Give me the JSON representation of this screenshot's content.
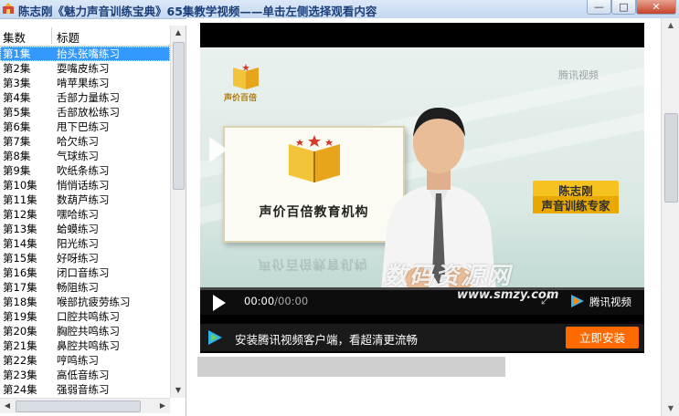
{
  "window": {
    "title": "陈志刚《魅力声音训练宝典》65集教学视频——单击左侧选择观看内容",
    "minimize_glyph": "—",
    "maximize_glyph": "□",
    "close_glyph": "✕"
  },
  "list": {
    "columns": [
      "集数",
      "标题"
    ],
    "selected_index": 0,
    "rows": [
      {
        "ep": "第1集",
        "title": "抬头张嘴练习"
      },
      {
        "ep": "第2集",
        "title": "耍嘴皮练习"
      },
      {
        "ep": "第3集",
        "title": "啃苹果练习"
      },
      {
        "ep": "第4集",
        "title": "舌部力量练习"
      },
      {
        "ep": "第5集",
        "title": "舌部放松练习"
      },
      {
        "ep": "第6集",
        "title": "甩下巴练习"
      },
      {
        "ep": "第7集",
        "title": "哈欠练习"
      },
      {
        "ep": "第8集",
        "title": "气球练习"
      },
      {
        "ep": "第9集",
        "title": "吹纸条练习"
      },
      {
        "ep": "第10集",
        "title": "悄悄话练习"
      },
      {
        "ep": "第11集",
        "title": "数葫芦练习"
      },
      {
        "ep": "第12集",
        "title": "嘿哈练习"
      },
      {
        "ep": "第13集",
        "title": "蛤蟆练习"
      },
      {
        "ep": "第14集",
        "title": "阳光练习"
      },
      {
        "ep": "第15集",
        "title": "好呀练习"
      },
      {
        "ep": "第16集",
        "title": "闭口音练习"
      },
      {
        "ep": "第17集",
        "title": "畅阻练习"
      },
      {
        "ep": "第18集",
        "title": "喉部抗疲劳练习"
      },
      {
        "ep": "第19集",
        "title": "口腔共鸣练习"
      },
      {
        "ep": "第20集",
        "title": "胸腔共鸣练习"
      },
      {
        "ep": "第21集",
        "title": "鼻腔共鸣练习"
      },
      {
        "ep": "第22集",
        "title": "哼鸣练习"
      },
      {
        "ep": "第23集",
        "title": "高低音练习"
      },
      {
        "ep": "第24集",
        "title": "强弱音练习"
      }
    ]
  },
  "video": {
    "small_logo_text": "声价百倍",
    "tencent_watermark": "腾讯视频",
    "board_text": "声价百倍教育机构",
    "name_line1": "陈志刚",
    "name_line2": "声音训练专家",
    "time_current": "00:00",
    "time_separator": "/",
    "time_total": "00:00",
    "player_brand": "腾讯视频",
    "progress": 0
  },
  "install": {
    "text": "安装腾讯视频客户端，看超清更流畅",
    "button": "立即安装"
  },
  "watermark": {
    "main": "数码资源网",
    "sub": "www.smzy.com"
  },
  "colors": {
    "selection": "#3399ff",
    "install_button": "#ff6a00",
    "name_tag": "#f6c21f"
  }
}
